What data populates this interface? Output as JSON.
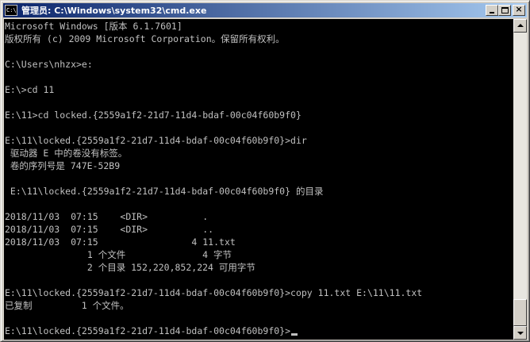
{
  "window": {
    "title": "管理员: C:\\Windows\\system32\\cmd.exe",
    "icon": "cmd-icon",
    "icon_text": "C:\\"
  },
  "buttons": {
    "minimize": "minimize-icon",
    "maximize": "maximize-icon",
    "close_glyph": "×"
  },
  "console": {
    "foreground": "#c0c0c0",
    "background": "#000000",
    "lines": [
      "Microsoft Windows [版本 6.1.7601]",
      "版权所有 (c) 2009 Microsoft Corporation。保留所有权利。",
      "",
      "C:\\Users\\nhzx>e:",
      "",
      "E:\\>cd 11",
      "",
      "E:\\11>cd locked.{2559a1f2-21d7-11d4-bdaf-00c04f60b9f0}",
      "",
      "E:\\11\\locked.{2559a1f2-21d7-11d4-bdaf-00c04f60b9f0}>dir",
      " 驱动器 E 中的卷没有标签。",
      " 卷的序列号是 747E-52B9",
      "",
      " E:\\11\\locked.{2559a1f2-21d7-11d4-bdaf-00c04f60b9f0} 的目录",
      "",
      "2018/11/03  07:15    <DIR>          .",
      "2018/11/03  07:15    <DIR>          ..",
      "2018/11/03  07:15                 4 11.txt",
      "               1 个文件              4 字节",
      "               2 个目录 152,220,852,224 可用字节",
      "",
      "E:\\11\\locked.{2559a1f2-21d7-11d4-bdaf-00c04f60b9f0}>copy 11.txt E:\\11\\11.txt",
      "已复制         1 个文件。",
      "",
      "E:\\11\\locked.{2559a1f2-21d7-11d4-bdaf-00c04f60b9f0}>"
    ]
  },
  "scrollbar": {
    "up": "scroll-up-arrow-icon",
    "down": "scroll-down-arrow-icon"
  }
}
